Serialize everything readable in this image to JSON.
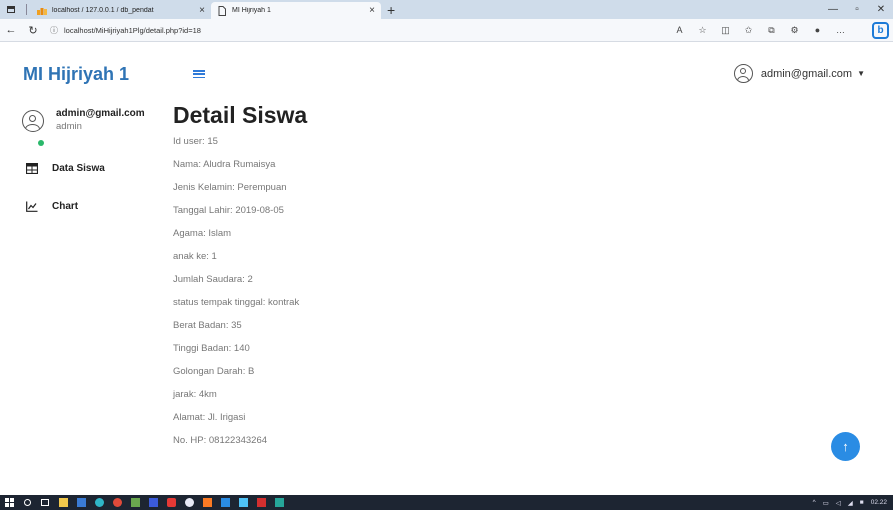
{
  "browser": {
    "tabs": [
      {
        "title": "localhost / 127.0.0.1 / db_pendat",
        "active": false
      },
      {
        "title": "MI Hijriyah 1",
        "active": true
      }
    ],
    "url": "localhost/MiHijriyah1Plg/detail.php?id=18"
  },
  "app": {
    "brand": "MI Hijriyah 1",
    "header_user": "admin@gmail.com",
    "accent_color": "#2f74b5"
  },
  "sidebar": {
    "user_email": "admin@gmail.com",
    "user_role": "admin",
    "items": [
      {
        "label": "Data Siswa",
        "icon": "table-icon"
      },
      {
        "label": "Chart",
        "icon": "chart-icon"
      }
    ]
  },
  "detail": {
    "title": "Detail Siswa",
    "fields": [
      "Id user: 15",
      "Nama: Aludra Rumaisya",
      "Jenis Kelamin: Perempuan",
      "Tanggal Lahir: 2019-08-05",
      "Agama: Islam",
      "anak ke: 1",
      "Jumlah Saudara: 2",
      "status tempak tinggal: kontrak",
      "Berat Badan: 35",
      "Tinggi Badan: 140",
      "Golongan Darah: B",
      "jarak: 4km",
      "Alamat: Jl. Irigasi",
      "No. HP: 08122343264"
    ]
  },
  "taskbar": {
    "clock": "02.22"
  }
}
